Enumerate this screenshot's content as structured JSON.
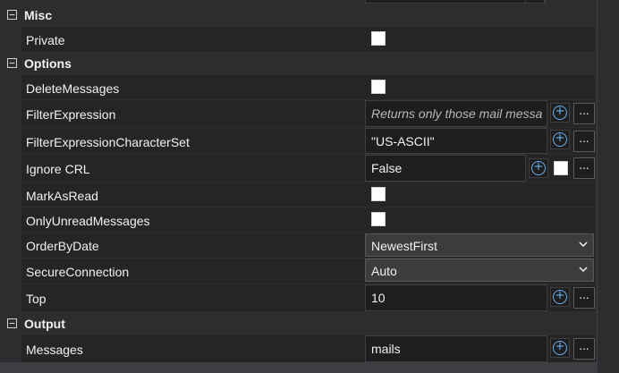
{
  "sections": {
    "misc": {
      "title": "Misc",
      "toggle": "⊟"
    },
    "options": {
      "title": "Options",
      "toggle": "⊟"
    },
    "output": {
      "title": "Output",
      "toggle": "⊟"
    }
  },
  "properties": {
    "private": {
      "name": "Private",
      "checked": false
    },
    "delete_messages": {
      "name": "DeleteMessages",
      "checked": false
    },
    "filter_expression": {
      "name": "FilterExpression",
      "placeholder": "Returns only those mail messa"
    },
    "filter_expression_charset": {
      "name": "FilterExpressionCharacterSet",
      "value": "\"US-ASCII\""
    },
    "ignore_crl": {
      "name": "Ignore CRL",
      "value": "False",
      "checked": false
    },
    "mark_as_read": {
      "name": "MarkAsRead",
      "checked": false
    },
    "only_unread_messages": {
      "name": "OnlyUnreadMessages",
      "checked": false
    },
    "order_by_date": {
      "name": "OrderByDate",
      "value": "NewestFirst"
    },
    "secure_connection": {
      "name": "SecureConnection",
      "value": "Auto"
    },
    "top": {
      "name": "Top",
      "value": "10"
    },
    "messages": {
      "name": "Messages",
      "value": "mails"
    }
  },
  "buttons": {
    "ellipsis": "...",
    "plus": "+"
  },
  "colors": {
    "background": "#2d2d30",
    "row": "#252526",
    "field": "#1e1e1e",
    "accent": "#6aaef0"
  },
  "icons": [
    "collapse-icon",
    "plus-circle-icon",
    "chevron-down-icon"
  ]
}
